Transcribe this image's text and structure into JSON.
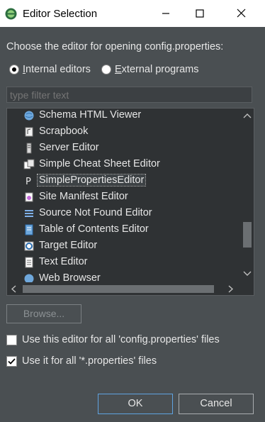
{
  "window": {
    "title": "Editor Selection"
  },
  "prompt": "Choose the editor for opening config.properties:",
  "radios": {
    "internal_label": "Internal editors",
    "external_label": "External programs",
    "selected": "internal"
  },
  "filter": {
    "placeholder": "type filter text",
    "value": ""
  },
  "editors": [
    {
      "label": "Schema HTML Viewer",
      "icon": "globe-icon"
    },
    {
      "label": "Scrapbook",
      "icon": "scrapbook-icon"
    },
    {
      "label": "Server Editor",
      "icon": "server-icon"
    },
    {
      "label": "Simple Cheat Sheet Editor",
      "icon": "cheatsheet-icon"
    },
    {
      "label": "SimplePropertiesEditor",
      "icon": "properties-icon",
      "selected": true
    },
    {
      "label": "Site Manifest Editor",
      "icon": "manifest-icon"
    },
    {
      "label": "Source Not Found Editor",
      "icon": "lines-icon"
    },
    {
      "label": "Table of Contents Editor",
      "icon": "toc-icon"
    },
    {
      "label": "Target Editor",
      "icon": "target-icon"
    },
    {
      "label": "Text Editor",
      "icon": "text-file-icon"
    },
    {
      "label": "Web Browser",
      "icon": "globe-icon"
    }
  ],
  "browse_label": "Browse...",
  "checkboxes": {
    "use_this_editor": {
      "label": "Use this editor for all 'config.properties' files",
      "checked": false
    },
    "use_for_all": {
      "label": "Use it for all '*.properties' files",
      "checked": true
    }
  },
  "buttons": {
    "ok": "OK",
    "cancel": "Cancel"
  },
  "colors": {
    "background": "#4a4f52",
    "list_bg": "#2f3234",
    "focus": "#5fa3e0"
  }
}
